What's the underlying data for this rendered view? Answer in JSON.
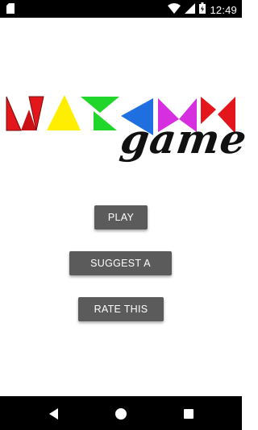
{
  "status_bar": {
    "time": "12:49",
    "icons": [
      "sd-card-icon",
      "wifi-icon",
      "cell-signal-icon",
      "battery-icon"
    ]
  },
  "logo": {
    "title_word": "game",
    "colors": [
      "#e3161b",
      "#ffee00",
      "#21d62a",
      "#1f6fe0",
      "#d52fe0",
      "#e3161b"
    ]
  },
  "buttons": {
    "play": "PLAY",
    "suggest": "SUGGEST A FEATURE",
    "rate": "RATE THIS GAME"
  },
  "nav_bar": {
    "icons": [
      "back-icon",
      "home-icon",
      "recents-icon"
    ]
  }
}
